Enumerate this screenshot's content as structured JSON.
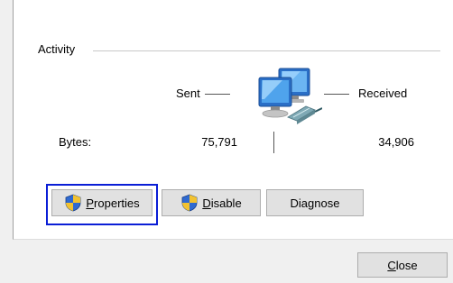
{
  "activity": {
    "group_label": "Activity",
    "sent_label": "Sent",
    "received_label": "Received",
    "bytes_label": "Bytes:",
    "bytes_sent": "75,791",
    "bytes_received": "34,906"
  },
  "buttons": {
    "properties_prefix": "",
    "properties_accel": "P",
    "properties_rest": "roperties",
    "disable_accel": "D",
    "disable_rest": "isable",
    "diagnose_label": "Diagnose",
    "close_accel": "C",
    "close_rest": "lose"
  },
  "icons": {
    "network": "network-computers-icon",
    "shield": "uac-shield-icon"
  },
  "colors": {
    "focus_ring": "#0a1ed6",
    "button_bg": "#e1e1e1"
  }
}
